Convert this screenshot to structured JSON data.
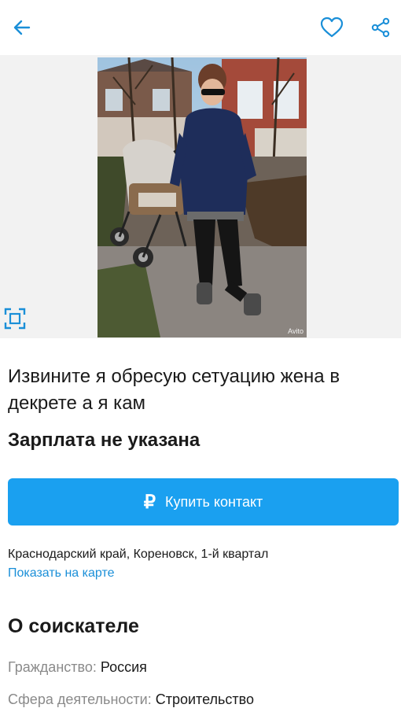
{
  "header": {
    "back_icon": "arrow-left-icon",
    "favorite_icon": "heart-outline-icon",
    "share_icon": "share-icon",
    "accent_color": "#1a8fd8"
  },
  "photo": {
    "watermark": "Avito",
    "expand_icon": "fullscreen-icon"
  },
  "listing": {
    "title": "Извините я обресую сетуацию жена в декрете а я кам",
    "salary": "Зарплата не указана",
    "buy_button": {
      "icon": "ruble-icon",
      "currency_symbol": "₽",
      "label": "Купить контакт",
      "color": "#1aa0f0"
    },
    "address": "Краснодарский край, Кореновск, 1-й квартал",
    "map_link": "Показать на карте"
  },
  "applicant": {
    "section_title": "О соискателе",
    "params": [
      {
        "label": "Гражданство:",
        "value": "Россия"
      },
      {
        "label": "Сфера деятельности:",
        "value": "Строительство"
      }
    ]
  }
}
